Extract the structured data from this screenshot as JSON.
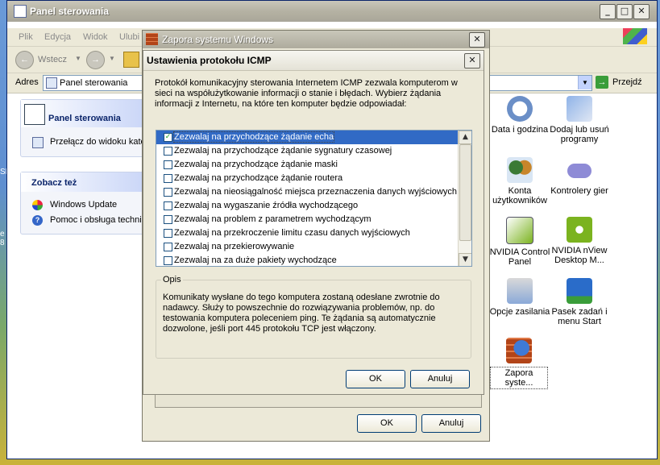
{
  "cp": {
    "title": "Panel sterowania",
    "menu": [
      "Plik",
      "Edycja",
      "Widok",
      "Ulubi"
    ],
    "back_label": "Wstecz",
    "address_label": "Adres",
    "address_value": "Panel sterowania",
    "go_label": "Przejdź",
    "side": {
      "panel_title": "Panel sterowania",
      "switch_view": "Przełącz do widoku kate",
      "see_also": "Zobacz też",
      "links": [
        "Windows Update",
        "Pomoc i obsługa technic"
      ]
    },
    "icons": [
      {
        "label": "Data i godzina",
        "icon": "clock-icon"
      },
      {
        "label": "Dodaj lub usuń programy",
        "icon": "add-remove-programs-icon"
      },
      {
        "label": "Konta użytkowników",
        "icon": "user-accounts-icon"
      },
      {
        "label": "Kontrolery gier",
        "icon": "game-controller-icon"
      },
      {
        "label": "NVIDIA Control Panel",
        "icon": "nvidia-icon"
      },
      {
        "label": "NVIDIA nView Desktop M...",
        "icon": "nvidia-nview-icon"
      },
      {
        "label": "Opcje zasilania",
        "icon": "power-icon"
      },
      {
        "label": "Pasek zadań i menu Start",
        "icon": "taskbar-icon"
      },
      {
        "label": "Zapora syste...",
        "icon": "firewall-icon"
      }
    ]
  },
  "fw": {
    "title": "Zapora systemu Windows",
    "ok": "OK",
    "cancel": "Anuluj"
  },
  "icmp": {
    "title": "Ustawienia protokołu ICMP",
    "intro": "Protokół komunikacyjny sterowania Internetem ICMP zezwala komputerom w sieci na współużytkowanie informacji o stanie i błędach. Wybierz żądania informacji z Internetu, na które ten komputer będzie odpowiadał:",
    "items": [
      {
        "label": "Zezwalaj na przychodzące żądanie echa",
        "checked": true
      },
      {
        "label": "Zezwalaj na przychodzące żądanie sygnatury czasowej",
        "checked": false
      },
      {
        "label": "Zezwalaj na przychodzące żądanie maski",
        "checked": false
      },
      {
        "label": "Zezwalaj na przychodzące żądanie routera",
        "checked": false
      },
      {
        "label": "Zezwalaj na nieosiągalność miejsca przeznaczenia danych wyjściowych",
        "checked": false
      },
      {
        "label": "Zezwalaj na wygaszanie źródła wychodzącego",
        "checked": false
      },
      {
        "label": "Zezwalaj na problem z parametrem wychodzącym",
        "checked": false
      },
      {
        "label": "Zezwalaj na przekroczenie limitu czasu danych wyjściowych",
        "checked": false
      },
      {
        "label": "Zezwalaj na przekierowywanie",
        "checked": false
      },
      {
        "label": "Zezwalaj na za duże pakiety wychodzące",
        "checked": false
      }
    ],
    "desc_title": "Opis",
    "desc": "Komunikaty wysłane do tego komputera zostaną odesłane zwrotnie do nadawcy. Służy to powszechnie do rozwiązywania problemów, np. do testowania komputera poleceniem ping. Te żądania są automatycznie dozwolone, jeśli port 445 protokołu TCP jest włączony.",
    "ok": "OK",
    "cancel": "Anuluj"
  },
  "desktop": {
    "edge_texts": [
      "SE",
      "e",
      "8"
    ]
  },
  "colors": {
    "title_active": "#0a246a",
    "selection": "#316ac5",
    "check": "#21a121",
    "dialog_bg": "#ece9d8"
  }
}
